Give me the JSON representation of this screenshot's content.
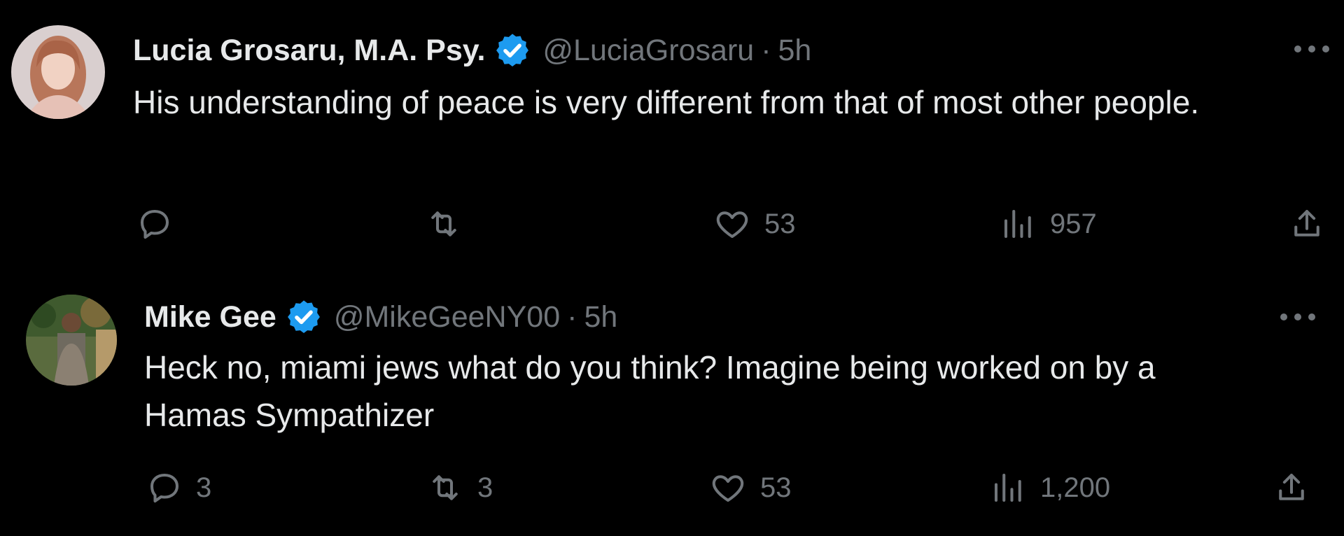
{
  "tweets": [
    {
      "display_name": "Lucia Grosaru, M.A. Psy.",
      "handle": "@LuciaGrosaru",
      "separator": "·",
      "time": "5h",
      "text": "His understanding of peace is very different from that of most other people.",
      "replies": "",
      "retweets": "",
      "likes": "53",
      "views": "957"
    },
    {
      "display_name": "Mike Gee",
      "handle": "@MikeGeeNY00",
      "separator": "·",
      "time": "5h",
      "text": "Heck no, miami jews what do you think? Imagine being worked on by a Hamas Sympathizer",
      "replies": "3",
      "retweets": "3",
      "likes": "53",
      "views": "1,200"
    }
  ],
  "icons": {
    "verified": "verified-badge-icon",
    "reply": "reply-icon",
    "retweet": "retweet-icon",
    "like": "heart-icon",
    "views": "views-icon",
    "share": "share-icon",
    "more": "more-icon"
  },
  "colors": {
    "background": "#000000",
    "text_primary": "#e7e9ea",
    "text_secondary": "#71767b",
    "verified_blue": "#1d9bf0"
  }
}
